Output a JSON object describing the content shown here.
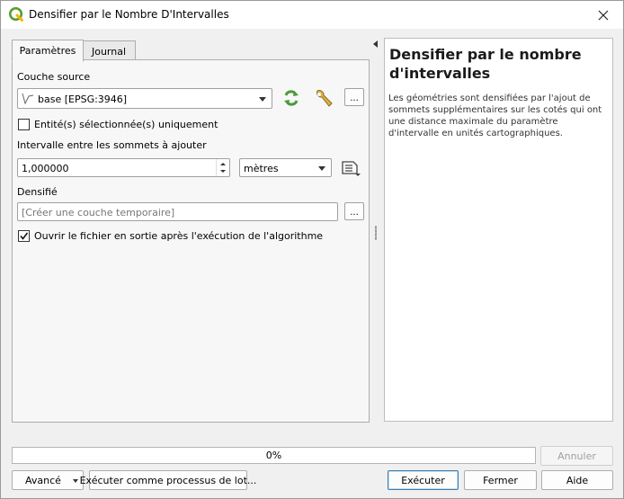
{
  "window": {
    "title": "Densifier par le Nombre D'Intervalles",
    "icon": "qgis-logo-icon",
    "accent_color": "#4a9a3a"
  },
  "tabs": [
    {
      "label": "Paramètres",
      "active": true
    },
    {
      "label": "Journal",
      "active": false
    }
  ],
  "form": {
    "source_label": "Couche source",
    "source_value": "base [EPSG:3946]",
    "selected_only_label": "Entité(s) sélectionnée(s) uniquement",
    "selected_only_checked": false,
    "interval_label": "Intervalle entre les sommets à ajouter",
    "interval_value": "1,000000",
    "unit_value": "mètres",
    "output_label": "Densifié",
    "output_placeholder": "[Créer une couche temporaire]",
    "open_output_label": "Ouvrir le fichier en sortie après l'exécution de l'algorithme",
    "open_output_checked": true,
    "ellipsis": "..."
  },
  "help": {
    "title": "Densifier par le nombre d'intervalles",
    "description": "Les géométries sont densifiées par l'ajout de sommets supplémentaires sur les cotés qui ont une distance maximale du paramètre d'intervalle en unités cartographiques."
  },
  "progress": {
    "text": "0%",
    "value": 0
  },
  "buttons": {
    "cancel": "Annuler",
    "advanced": "Avancé",
    "batch": "Exécuter comme processus de lot...",
    "run": "Exécuter",
    "close": "Fermer",
    "help": "Aide"
  }
}
